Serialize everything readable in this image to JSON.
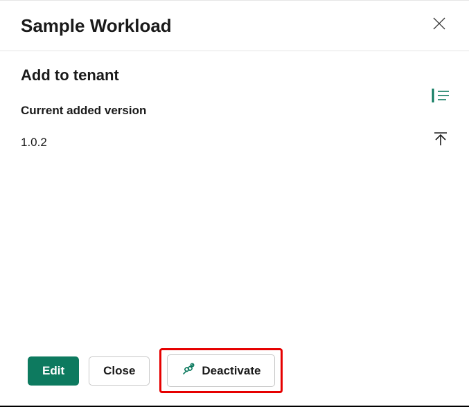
{
  "header": {
    "title": "Sample Workload"
  },
  "section": {
    "title": "Add to tenant",
    "versionLabel": "Current added version",
    "versionValue": "1.0.2"
  },
  "buttons": {
    "edit": "Edit",
    "close": "Close",
    "deactivate": "Deactivate"
  },
  "colors": {
    "accent": "#0d7a5f",
    "highlight": "#e60000"
  }
}
